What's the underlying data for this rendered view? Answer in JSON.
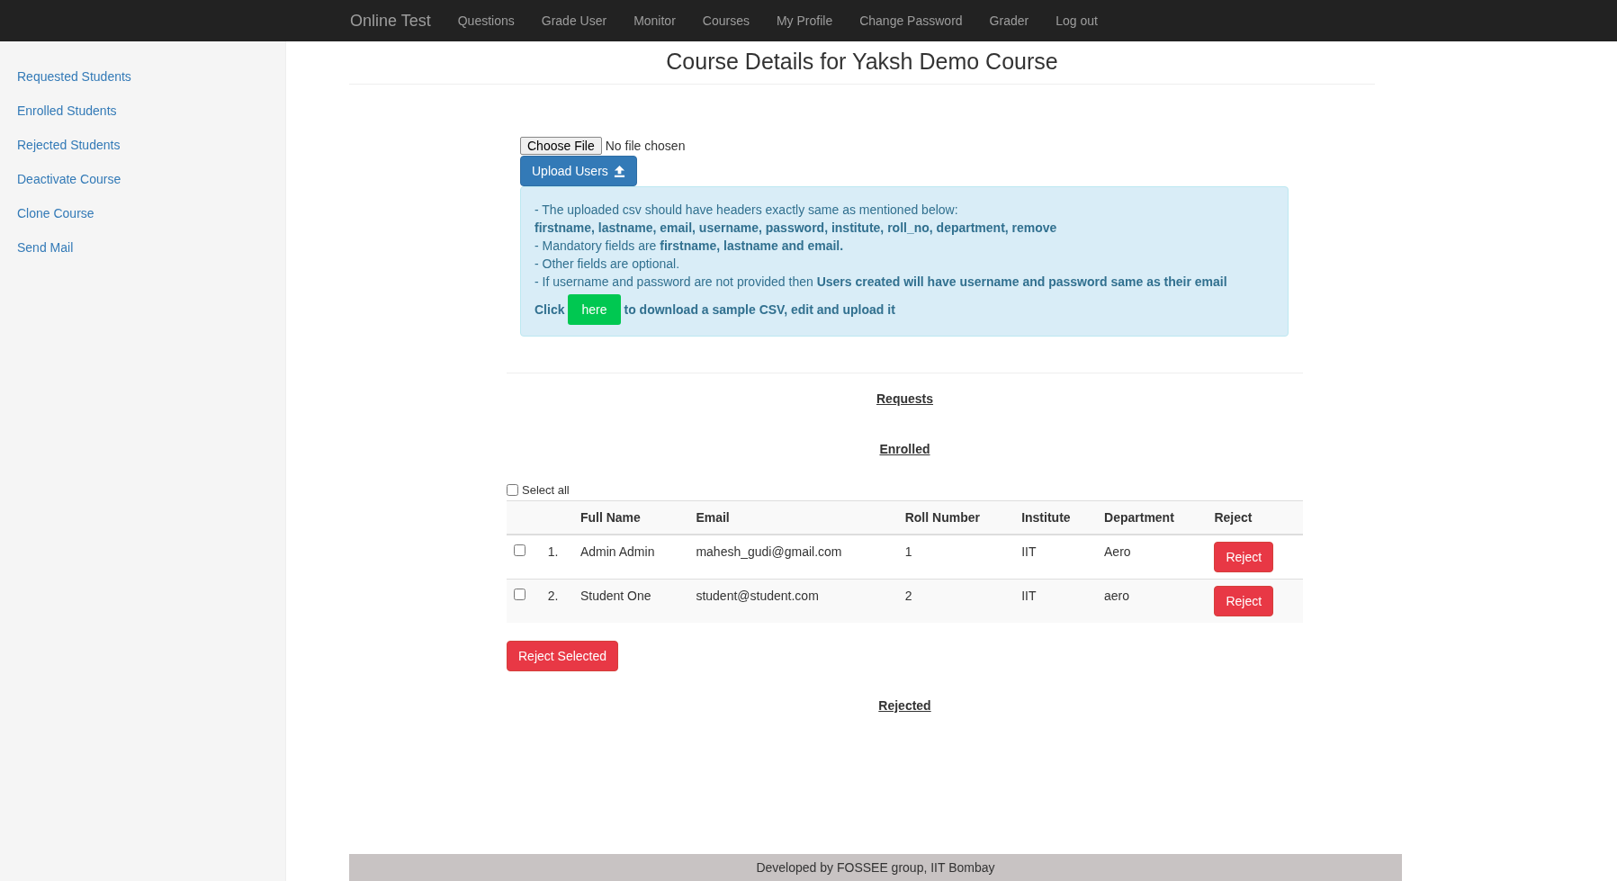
{
  "navbar": {
    "brand": "Online Test",
    "links": [
      "Questions",
      "Grade User",
      "Monitor",
      "Courses",
      "My Profile",
      "Change Password",
      "Grader",
      "Log out"
    ]
  },
  "sidebar": {
    "items": [
      "Requested Students",
      "Enrolled Students",
      "Rejected Students",
      "Deactivate Course",
      "Clone Course",
      "Send Mail"
    ]
  },
  "page_title": "Course Details for Yaksh Demo Course",
  "upload": {
    "choose_button": "Choose File",
    "file_status": "No file chosen",
    "upload_button": "Upload Users"
  },
  "info": {
    "lines": [
      {
        "kind": "plain",
        "text": "- The uploaded csv should have headers exactly same as mentioned below:"
      },
      {
        "kind": "bold",
        "text": "firstname, lastname, email, username, password, institute, roll_no, department, remove"
      },
      {
        "kind": "plain",
        "text": "- Mandatory fields are **firstname, lastname and email.**"
      },
      {
        "kind": "plain",
        "text": "- Other fields are optional."
      },
      {
        "kind": "plain",
        "text": "- If username and password are not provided then **Users created will have username and password same as their email**"
      }
    ],
    "download": {
      "before": "Click",
      "button": "here",
      "after": "to download a sample CSV, edit and upload it"
    }
  },
  "sections": {
    "requests": "Requests",
    "enrolled": "Enrolled",
    "rejected": "Rejected"
  },
  "select_all": {
    "label": "Select all",
    "checked": false
  },
  "table": {
    "columns": [
      "",
      "",
      "Full Name",
      "Email",
      "Roll Number",
      "Institute",
      "Department",
      "Reject"
    ],
    "rows": [
      {
        "checked": false,
        "index": "1.",
        "name": "Admin Admin",
        "email": "mahesh_gudi@gmail.com",
        "roll": "1",
        "institute": "IIT",
        "department": "Aero",
        "button": "Reject"
      },
      {
        "checked": false,
        "index": "2.",
        "name": "Student One",
        "email": "student@student.com",
        "roll": "2",
        "institute": "IIT",
        "department": "aero",
        "button": "Reject"
      }
    ]
  },
  "reject_selected": "Reject Selected",
  "footer": "Developed by FOSSEE group, IIT Bombay"
}
